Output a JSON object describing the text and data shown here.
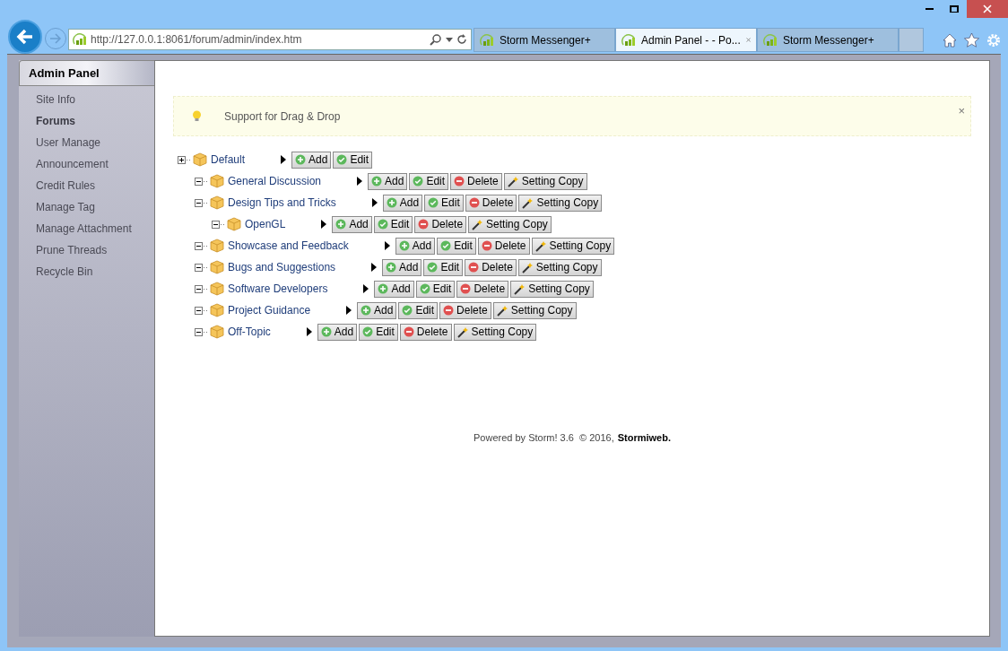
{
  "browser": {
    "address": "http://127.0.0.1:8061/forum/admin/index.htm",
    "tabs": [
      {
        "title": "Storm Messenger+",
        "selected": false
      },
      {
        "title": "Admin Panel - - Po...",
        "selected": true
      },
      {
        "title": "Storm Messenger+",
        "selected": false
      }
    ]
  },
  "sidebar": {
    "title": "Admin Panel",
    "items": [
      {
        "label": "Site Info",
        "selected": false
      },
      {
        "label": "Forums",
        "selected": true
      },
      {
        "label": "User Manage",
        "selected": false
      },
      {
        "label": "Announcement",
        "selected": false
      },
      {
        "label": "Credit Rules",
        "selected": false
      },
      {
        "label": "Manage Tag",
        "selected": false
      },
      {
        "label": "Manage Attachment",
        "selected": false
      },
      {
        "label": "Prune Threads",
        "selected": false
      },
      {
        "label": "Recycle Bin",
        "selected": false
      }
    ]
  },
  "notice": {
    "text": "Support for Drag & Drop",
    "close": "×"
  },
  "tree": [
    {
      "label": "Default",
      "expanded": false,
      "actions": [
        {
          "kind": "add",
          "label": "Add"
        },
        {
          "kind": "edit",
          "label": "Edit"
        }
      ],
      "children": [
        {
          "label": "General Discussion",
          "expanded": true,
          "actions": [
            {
              "kind": "add",
              "label": "Add"
            },
            {
              "kind": "edit",
              "label": "Edit"
            },
            {
              "kind": "delete",
              "label": "Delete"
            },
            {
              "kind": "copy",
              "label": "Setting Copy"
            }
          ]
        },
        {
          "label": "Design Tips and Tricks",
          "expanded": true,
          "actions": [
            {
              "kind": "add",
              "label": "Add"
            },
            {
              "kind": "edit",
              "label": "Edit"
            },
            {
              "kind": "delete",
              "label": "Delete"
            },
            {
              "kind": "copy",
              "label": "Setting Copy"
            }
          ],
          "children": [
            {
              "label": "OpenGL",
              "expanded": true,
              "actions": [
                {
                  "kind": "add",
                  "label": "Add"
                },
                {
                  "kind": "edit",
                  "label": "Edit"
                },
                {
                  "kind": "delete",
                  "label": "Delete"
                },
                {
                  "kind": "copy",
                  "label": "Setting Copy"
                }
              ]
            }
          ]
        },
        {
          "label": "Showcase and Feedback",
          "expanded": true,
          "actions": [
            {
              "kind": "add",
              "label": "Add"
            },
            {
              "kind": "edit",
              "label": "Edit"
            },
            {
              "kind": "delete",
              "label": "Delete"
            },
            {
              "kind": "copy",
              "label": "Setting Copy"
            }
          ]
        },
        {
          "label": "Bugs and Suggestions",
          "expanded": true,
          "actions": [
            {
              "kind": "add",
              "label": "Add"
            },
            {
              "kind": "edit",
              "label": "Edit"
            },
            {
              "kind": "delete",
              "label": "Delete"
            },
            {
              "kind": "copy",
              "label": "Setting Copy"
            }
          ]
        },
        {
          "label": "Software Developers",
          "expanded": true,
          "actions": [
            {
              "kind": "add",
              "label": "Add"
            },
            {
              "kind": "edit",
              "label": "Edit"
            },
            {
              "kind": "delete",
              "label": "Delete"
            },
            {
              "kind": "copy",
              "label": "Setting Copy"
            }
          ]
        },
        {
          "label": "Project Guidance",
          "expanded": true,
          "actions": [
            {
              "kind": "add",
              "label": "Add"
            },
            {
              "kind": "edit",
              "label": "Edit"
            },
            {
              "kind": "delete",
              "label": "Delete"
            },
            {
              "kind": "copy",
              "label": "Setting Copy"
            }
          ]
        },
        {
          "label": "Off-Topic",
          "expanded": true,
          "actions": [
            {
              "kind": "add",
              "label": "Add"
            },
            {
              "kind": "edit",
              "label": "Edit"
            },
            {
              "kind": "delete",
              "label": "Delete"
            },
            {
              "kind": "copy",
              "label": "Setting Copy"
            }
          ]
        }
      ]
    }
  ],
  "footer": {
    "text": "Powered by Storm! 3.6  © 2016,",
    "brand": "Stormiweb."
  }
}
